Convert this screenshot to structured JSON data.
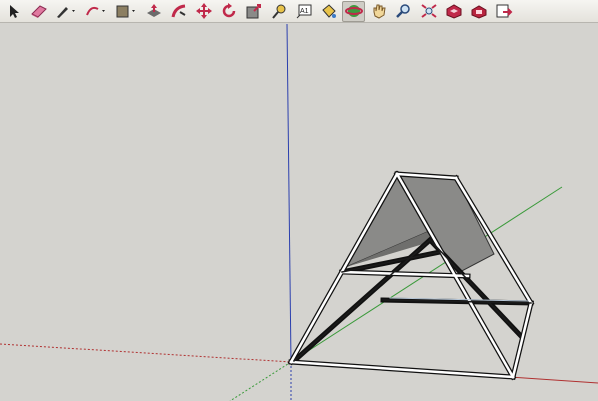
{
  "toolbar": {
    "tools": [
      {
        "id": "select",
        "icon": "arrow-cursor-icon"
      },
      {
        "id": "eraser",
        "icon": "eraser-icon"
      },
      {
        "id": "pencil",
        "icon": "pencil-icon",
        "dropdown": true
      },
      {
        "id": "arc",
        "icon": "arc-icon",
        "dropdown": true
      },
      {
        "id": "shapes",
        "icon": "rectangle-icon",
        "dropdown": true
      },
      {
        "id": "push-pull",
        "icon": "push-pull-icon"
      },
      {
        "id": "follow-me",
        "icon": "follow-me-icon"
      },
      {
        "id": "move",
        "icon": "move-icon"
      },
      {
        "id": "rotate",
        "icon": "rotate-icon"
      },
      {
        "id": "scale",
        "icon": "scale-icon"
      },
      {
        "id": "tape-measure",
        "icon": "tape-measure-icon"
      },
      {
        "id": "text",
        "icon": "text-icon",
        "label": "A1"
      },
      {
        "id": "paint-bucket",
        "icon": "paint-bucket-icon"
      },
      {
        "id": "orbit",
        "icon": "orbit-icon",
        "active": true
      },
      {
        "id": "pan",
        "icon": "pan-hand-icon"
      },
      {
        "id": "zoom",
        "icon": "zoom-icon"
      },
      {
        "id": "zoom-extents",
        "icon": "zoom-extents-icon"
      },
      {
        "id": "warehouse",
        "icon": "3d-warehouse-icon"
      },
      {
        "id": "extension-warehouse",
        "icon": "extension-warehouse-icon"
      },
      {
        "id": "layout",
        "icon": "send-to-layout-icon"
      }
    ]
  },
  "colors": {
    "background": "#d4d3cf",
    "blue_axis": "#2b3fae",
    "green_axis": "#3a9a3a",
    "red_axis": "#b03030",
    "roof": "#8a8a88"
  }
}
